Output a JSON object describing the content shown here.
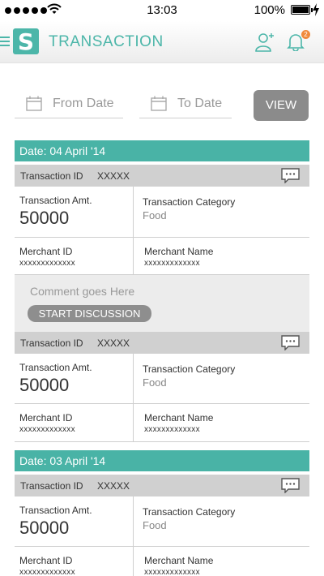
{
  "status_bar": {
    "time": "13:03",
    "battery_text": "100%",
    "battery_level": 1.0
  },
  "header": {
    "logo_letter": "S",
    "title": "TRANSACTION",
    "notification_count": "2",
    "accent_color": "#4cb6a9"
  },
  "filter": {
    "from_placeholder": "From Date",
    "to_placeholder": "To Date",
    "view_label": "VIEW"
  },
  "labels": {
    "transaction_id": "Transaction ID",
    "amount": "Transaction Amt.",
    "category": "Transaction Category",
    "merchant_id": "Merchant ID",
    "merchant_name": "Merchant Name"
  },
  "groups": [
    {
      "date": "Date: 04 April '14",
      "transactions": [
        {
          "id": "XXXXX",
          "amount": "50000",
          "category": "Food",
          "merchant_id": "xxxxxxxxxxxxx",
          "merchant_name": "xxxxxxxxxxxxx"
        },
        {
          "id": "XXXXX",
          "amount": "50000",
          "category": "Food",
          "merchant_id": "xxxxxxxxxxxxx",
          "merchant_name": "xxxxxxxxxxxxx"
        }
      ]
    },
    {
      "date": "Date: 03 April '14",
      "transactions": [
        {
          "id": "XXXXX",
          "amount": "50000",
          "category": "Food",
          "merchant_id": "xxxxxxxxxxxxx",
          "merchant_name": "xxxxxxxxxxxxx"
        }
      ]
    }
  ],
  "comment": {
    "text": "Comment goes Here",
    "button_label": "START DISCUSSION"
  }
}
